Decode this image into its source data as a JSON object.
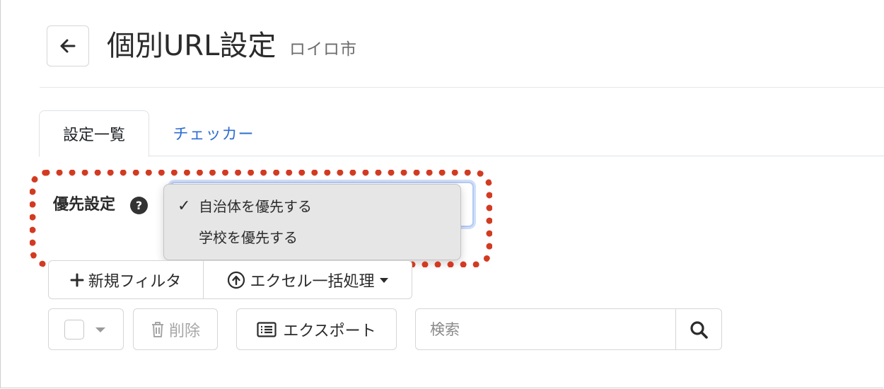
{
  "header": {
    "title": "個別URL設定",
    "subtitle": "ロイロ市",
    "back_icon": "arrow-left-icon"
  },
  "tabs": [
    {
      "label": "設定一覧",
      "active": true
    },
    {
      "label": "チェッカー",
      "active": false
    }
  ],
  "priority": {
    "label": "優先設定",
    "help_icon_text": "?",
    "options": [
      {
        "label": "自治体を優先する",
        "selected": true,
        "check_mark": "✓"
      },
      {
        "label": "学校を優先する",
        "selected": false,
        "check_mark": ""
      }
    ]
  },
  "toolbar": {
    "new_filter_label": "新規フィルタ",
    "excel_label": "エクセル一括処理",
    "delete_label": "削除",
    "export_label": "エクスポート",
    "search_placeholder": "検索"
  },
  "colors": {
    "highlight": "#d23b22",
    "tab_link": "#2f6ed1",
    "focus_ring": "#b4c9f3",
    "dropdown_bg": "#e6e6e6"
  },
  "icons": {
    "plus": "plus-icon",
    "upload": "upload-circle-icon",
    "caret": "caret-down-icon",
    "trash": "trash-icon",
    "list": "list-icon",
    "search": "search-icon",
    "help": "question-circle-icon"
  }
}
